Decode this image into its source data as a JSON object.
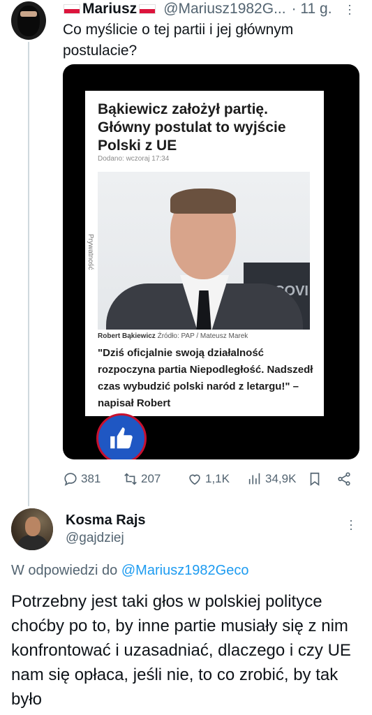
{
  "tweet": {
    "author_name": "Mariusz",
    "handle": "@Mariusz1982G...",
    "time": "· 11 g.",
    "text": "Co myślicie o tej partii i jej głównym postulacie?",
    "media": {
      "headline": "Bąkiewicz założył partię. Główny postulat to wyjście Polski z UE",
      "date": "Dodano: wczoraj 17:34",
      "privacy": "Prywatność",
      "caption_name": "Robert Bąkiewicz",
      "caption_source": "Źródło: PAP / Mateusz Marek",
      "quote": "\"Dziś oficjalnie swoją działalność rozpoczyna partia Niepodległość. Nadszedł czas wybudzić polski naród z letargu!\" – napisał Robert",
      "photo_text": "COVI"
    },
    "actions": {
      "replies": "381",
      "reposts": "207",
      "likes": "1,1K",
      "views": "34,9K"
    }
  },
  "reply": {
    "author_name": "Kosma Rajs",
    "handle": "@gajdziej",
    "replying_to_prefix": "W odpowiedzi do",
    "replying_to_handle": "@Mariusz1982Geco",
    "text": "Potrzebny jest taki głos w polskiej polityce choćby po to, by inne partie musiały się z nim konfrontować i uzasadniać, dlaczego i czy UE nam się opłaca, jeśli nie, to co zrobić, by tak było"
  },
  "colors": {
    "link": "#1d9bf0",
    "secondary_text": "#536471",
    "thread_line": "#cfd9de",
    "badge_blue": "#1f57c3"
  }
}
